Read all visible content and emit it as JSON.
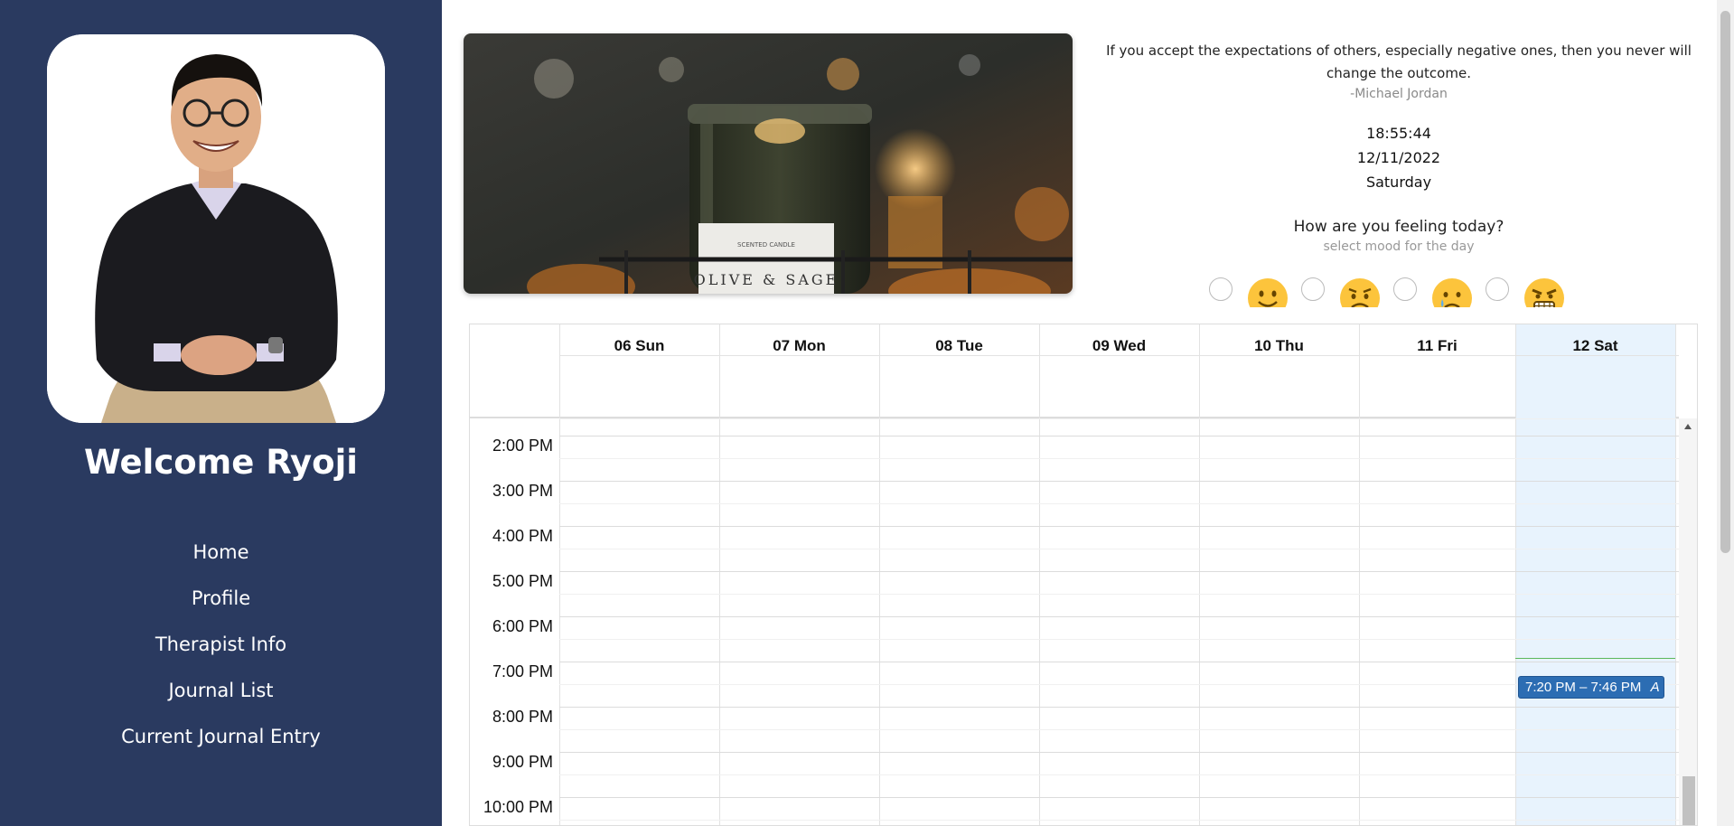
{
  "sidebar": {
    "welcome": "Welcome Ryoji",
    "nav": [
      {
        "label": "Home"
      },
      {
        "label": "Profile"
      },
      {
        "label": "Therapist Info"
      },
      {
        "label": "Journal List"
      },
      {
        "label": "Current Journal Entry"
      }
    ],
    "bg_color": "#2a3a60"
  },
  "hero": {
    "label_text": "OLIVE & SAGE",
    "small_text": "SCENTED CANDLE"
  },
  "quote": {
    "text": "If you accept the expectations of others, especially negative ones, then you never will change the outcome.",
    "author": "-Michael Jordan"
  },
  "clock": {
    "time": "18:55:44",
    "date": "12/11/2022",
    "weekday": "Saturday"
  },
  "mood": {
    "title": "How are you feeling today?",
    "subtitle": "select mood for the day",
    "options": [
      {
        "icon": "smile-emoji-icon"
      },
      {
        "icon": "worried-emoji-icon"
      },
      {
        "icon": "crying-emoji-icon"
      },
      {
        "icon": "angry-emoji-icon"
      }
    ]
  },
  "calendar": {
    "days": [
      "06 Sun",
      "07 Mon",
      "08 Tue",
      "09 Wed",
      "10 Thu",
      "11 Fri",
      "12 Sat"
    ],
    "times": [
      "2:00 PM",
      "3:00 PM",
      "4:00 PM",
      "5:00 PM",
      "6:00 PM",
      "7:00 PM",
      "8:00 PM",
      "9:00 PM",
      "10:00 PM"
    ],
    "today_color": "#e8f3fd",
    "event": {
      "label": "7:20 PM – 7:46 PM",
      "suffix": "A",
      "color": "#2c6db3"
    }
  }
}
